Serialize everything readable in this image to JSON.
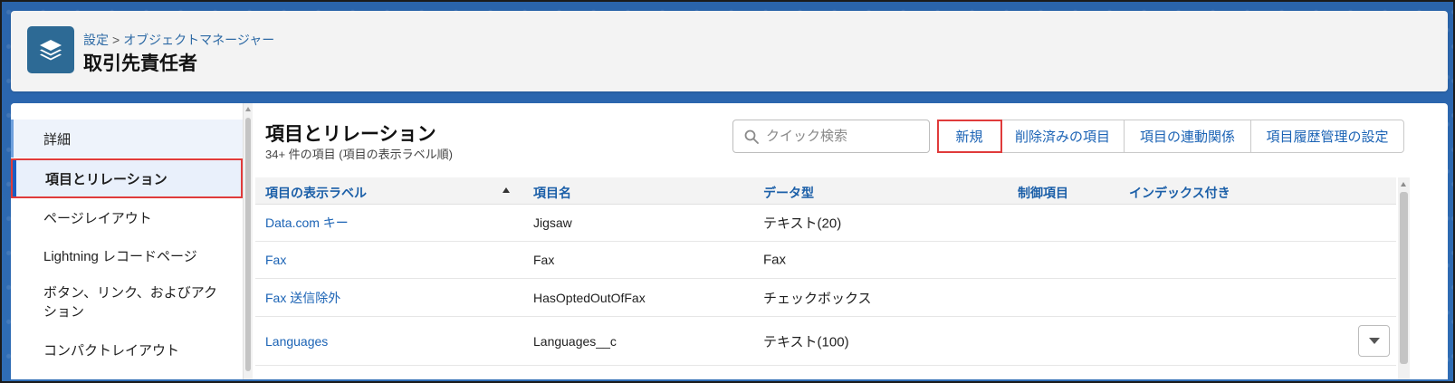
{
  "breadcrumb": {
    "root": "設定",
    "separator": ">",
    "current": "オブジェクトマネージャー"
  },
  "page_title": "取引先責任者",
  "sidebar": {
    "items": [
      {
        "label": "詳細"
      },
      {
        "label": "項目とリレーション"
      },
      {
        "label": "ページレイアウト"
      },
      {
        "label": "Lightning レコードページ"
      },
      {
        "label": "ボタン、リンク、およびアクション"
      },
      {
        "label": "コンパクトレイアウト"
      }
    ]
  },
  "main": {
    "title": "項目とリレーション",
    "subtitle": "34+ 件の項目 (項目の表示ラベル順)",
    "search_placeholder": "クイック検索",
    "buttons": [
      {
        "label": "新規"
      },
      {
        "label": "削除済みの項目"
      },
      {
        "label": "項目の連動関係"
      },
      {
        "label": "項目履歴管理の設定"
      }
    ],
    "columns": [
      "項目の表示ラベル",
      "項目名",
      "データ型",
      "制御項目",
      "インデックス付き"
    ],
    "rows": [
      {
        "label": "Data.com キー",
        "api": "Jigsaw",
        "type": "テキスト(20)",
        "ctrl": "",
        "indexed": ""
      },
      {
        "label": "Fax",
        "api": "Fax",
        "type": "Fax",
        "ctrl": "",
        "indexed": ""
      },
      {
        "label": "Fax 送信除外",
        "api": "HasOptedOutOfFax",
        "type": "チェックボックス",
        "ctrl": "",
        "indexed": ""
      },
      {
        "label": "Languages",
        "api": "Languages__c",
        "type": "テキスト(100)",
        "ctrl": "",
        "indexed": ""
      }
    ]
  },
  "icons": {
    "app": "layers-icon",
    "search": "search-icon",
    "sort": "sort-ascending-icon",
    "row_menu": "chevron-down-icon"
  },
  "colors": {
    "accent": "#1b63b5",
    "highlight_box": "#e03b3b",
    "app_icon_bg": "#2d6a95"
  }
}
